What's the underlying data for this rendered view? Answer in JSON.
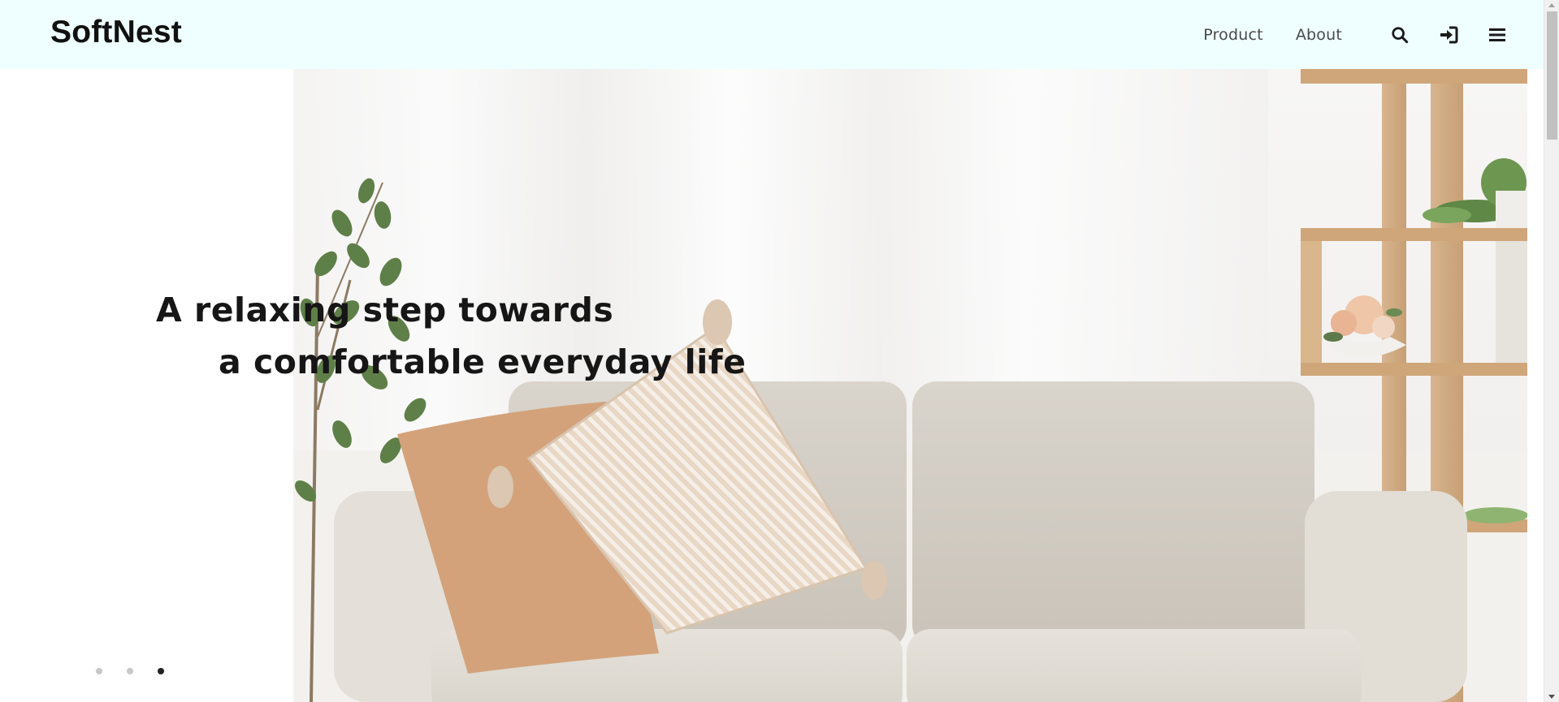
{
  "brand": {
    "name": "SoftNest"
  },
  "nav": {
    "links": [
      {
        "label": "Product"
      },
      {
        "label": "About"
      }
    ],
    "icons": [
      "search-icon",
      "sign-in-icon",
      "menu-icon"
    ]
  },
  "hero": {
    "headline_line1": "A relaxing step towards",
    "headline_line2": "a comfortable everyday life",
    "image": "living-room-sofa-photo",
    "slides_total": 3,
    "active_slide": 3
  },
  "colors": {
    "header_bg": "#effefe",
    "text": "#161616",
    "dot_inactive": "#c8c8c8",
    "dot_active": "#222222"
  }
}
